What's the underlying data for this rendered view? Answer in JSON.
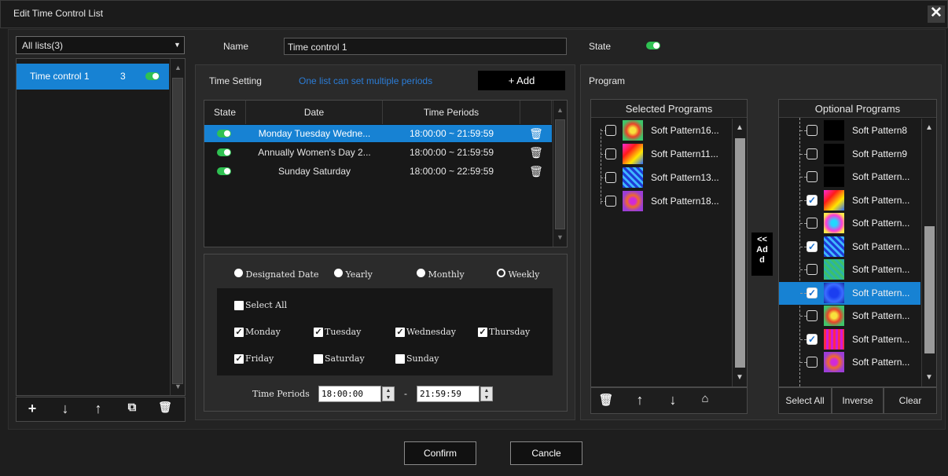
{
  "window": {
    "title": "Edit Time Control List",
    "close": "✕"
  },
  "left": {
    "selector": "All lists(3)",
    "items": [
      {
        "name": "Time control 1",
        "count": "3"
      }
    ],
    "buttons": [
      "+",
      "↓",
      "↑",
      "⧉",
      "🗑"
    ]
  },
  "form": {
    "name_label": "Name",
    "name_value": "Time control 1",
    "state_label": "State"
  },
  "time_setting": {
    "label": "Time Setting",
    "hint": "One list can set multiple periods",
    "add_label": "+ Add",
    "columns": [
      "State",
      "Date",
      "Time Periods"
    ],
    "rows": [
      {
        "date": "Monday Tuesday Wedne...",
        "period": "18:00:00 ~ 21:59:59",
        "selected": true
      },
      {
        "date": "Annually Women's Day 2...",
        "period": "18:00:00 ~ 21:59:59",
        "selected": false
      },
      {
        "date": "Sunday Saturday",
        "period": "18:00:00 ~ 22:59:59",
        "selected": false
      }
    ],
    "modes": [
      "Designated Date",
      "Yearly",
      "Monthly",
      "Weekly"
    ],
    "select_all": "Select All",
    "days": [
      "Monday",
      "Tuesday",
      "Wednesday",
      "Thursday",
      "Friday",
      "Saturday",
      "Sunday"
    ],
    "time_periods_label": "Time Periods",
    "start": "18:00:00",
    "dash": "-",
    "end": "21:59:59"
  },
  "program": {
    "label": "Program",
    "selected_title": "Selected Programs",
    "selected": [
      "Soft Pattern16...",
      "Soft Pattern11...",
      "Soft Pattern13...",
      "Soft Pattern18..."
    ],
    "add_label_1": "<<",
    "add_label_2": "Ad",
    "add_label_3": "d",
    "optional_title": "Optional Programs",
    "optional": [
      "Soft Pattern8",
      "Soft Pattern9",
      "Soft Pattern...",
      "Soft Pattern...",
      "Soft Pattern...",
      "Soft Pattern...",
      "Soft Pattern...",
      "Soft Pattern...",
      "Soft Pattern...",
      "Soft Pattern...",
      "Soft Pattern...",
      "Soft Pattern..."
    ],
    "select_all": "Select All",
    "inverse": "Inverse",
    "clear": "Clear"
  },
  "footer": {
    "confirm": "Confirm",
    "cancel": "Cancle"
  },
  "colors": {
    "accent": "#1782d3",
    "toggle_on": "#2fc152",
    "hint": "#2b7cd6"
  }
}
